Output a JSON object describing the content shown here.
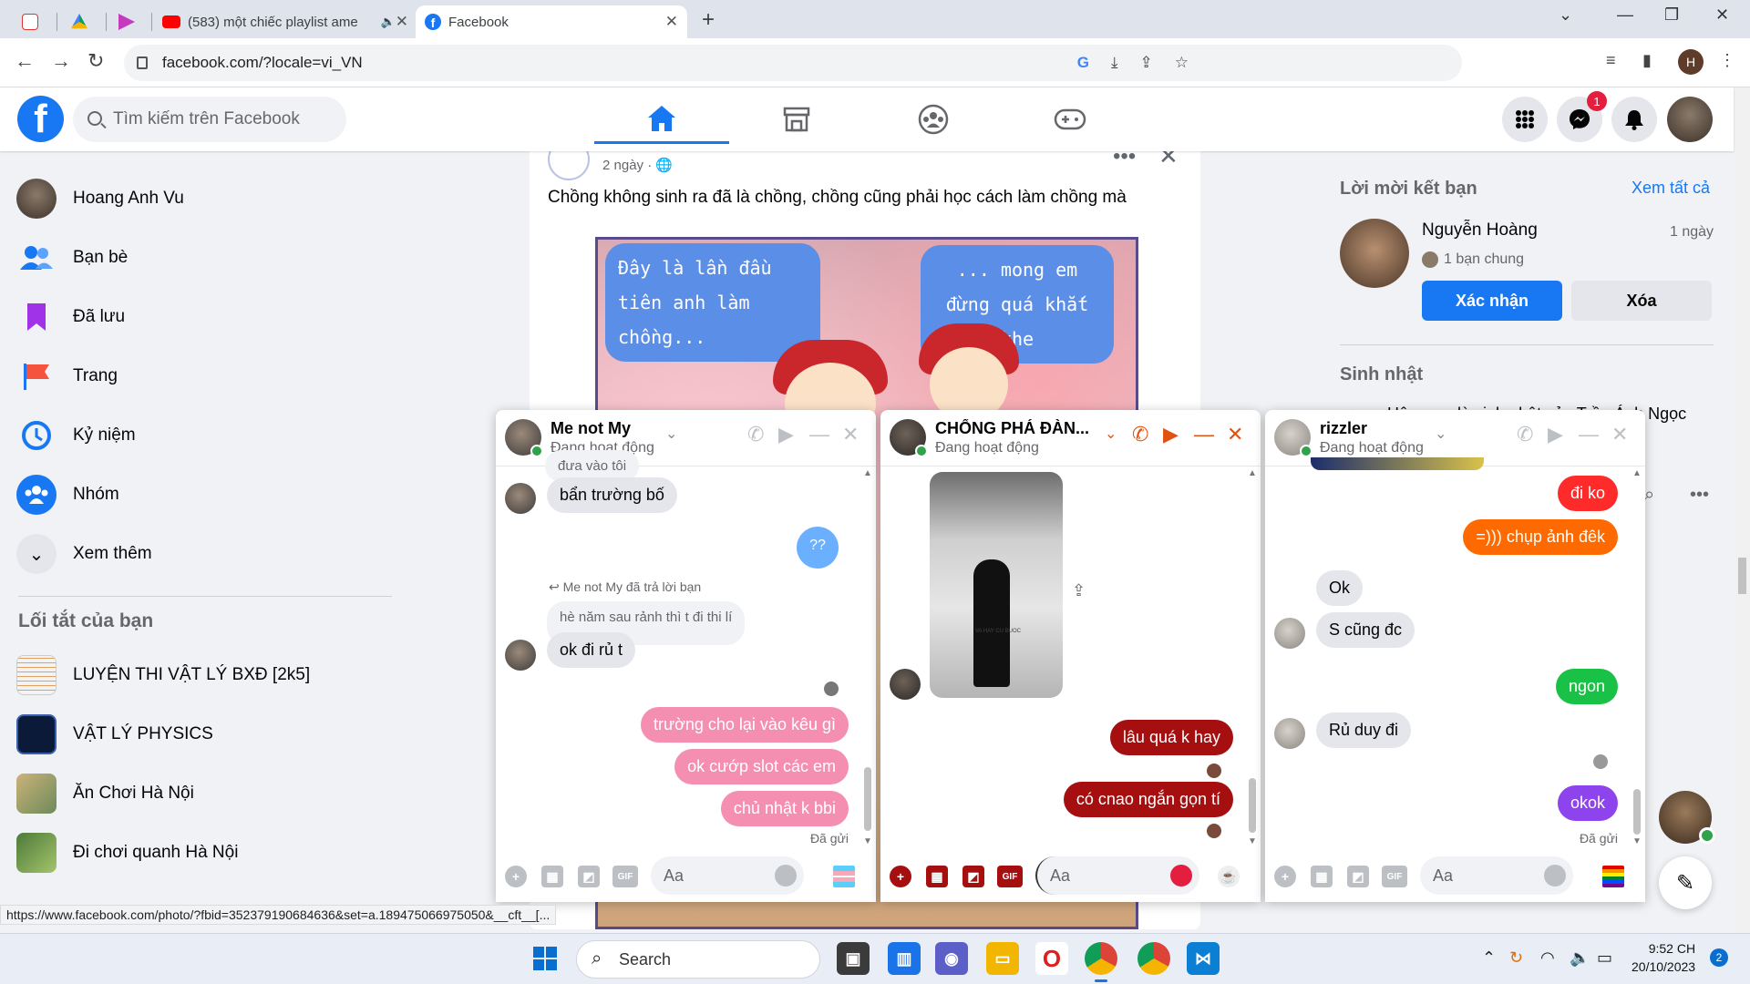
{
  "browser": {
    "tabs": [
      {
        "title": ""
      },
      {
        "title": ""
      },
      {
        "title": ""
      },
      {
        "title": "(583) một chiếc playlist ame"
      },
      {
        "title": "Facebook"
      }
    ],
    "url": "facebook.com/?locale=vi_VN",
    "profile_initial": "H",
    "status_url": "https://www.facebook.com/photo/?fbid=352379190684636&set=a.189475066975050&__cft__[..."
  },
  "header": {
    "search_placeholder": "Tìm kiếm trên Facebook",
    "messenger_badge": "1"
  },
  "sidebar": {
    "items": [
      {
        "label": "Hoang Anh Vu",
        "icon": "avatar"
      },
      {
        "label": "Bạn bè",
        "icon": "friends-icon"
      },
      {
        "label": "Đã lưu",
        "icon": "bookmark-icon"
      },
      {
        "label": "Trang",
        "icon": "flag-icon"
      },
      {
        "label": "Kỷ niệm",
        "icon": "clock-icon"
      },
      {
        "label": "Nhóm",
        "icon": "groups-icon"
      },
      {
        "label": "Xem thêm",
        "icon": "chevron-down-icon"
      }
    ],
    "shortcuts_title": "Lối tắt của bạn",
    "shortcuts": [
      {
        "label": "LUYỆN THI VẬT LÝ BXĐ [2k5]"
      },
      {
        "label": "VẬT LÝ PHYSICS"
      },
      {
        "label": "Ăn Chơi Hà Nội"
      },
      {
        "label": "Đi chơi quanh Hà Nội"
      }
    ]
  },
  "post": {
    "time": "2 ngày ·",
    "text": "Chồng không sinh ra đã là chồng, chồng cũng phải học cách làm chồng mà",
    "comic_bubble_left": "Đây là lần đầu tiên anh làm chồng...",
    "comic_bubble_right": "... mong em đừng quá khắt khe"
  },
  "right": {
    "friend_requests_title": "Lời mời kết bạn",
    "see_all": "Xem tất cả",
    "request": {
      "name": "Nguyễn Hoàng",
      "time": "1 ngày",
      "mutual": "1 bạn chung",
      "confirm": "Xác nhận",
      "delete": "Xóa"
    },
    "birthdays_title": "Sinh nhật",
    "birthday_text": "Hôm nay là sinh nhật của Trần Ánh Ngọc"
  },
  "chats": [
    {
      "name": "Me not My",
      "status": "Đang hoạt động",
      "reply_note": "Me not My đã trả lời bạn",
      "quoted": "hè năm sau rảnh thì t đi thi lí",
      "partial_top": "đưa vào tôi",
      "messages": [
        {
          "text": "bẩn trường bố",
          "dir": "in"
        },
        {
          "text": "??",
          "dir": "out"
        },
        {
          "text": "ok đi rủ t",
          "dir": "in"
        },
        {
          "text": "trường cho lại vào kêu gì",
          "dir": "out"
        },
        {
          "text": "ok cướp slot các em",
          "dir": "out"
        },
        {
          "text": "chủ nhật k bbi",
          "dir": "out"
        }
      ],
      "sent": "Đã gửi",
      "input_placeholder": "Aa"
    },
    {
      "name": "CHỐNG PHÁ ĐÀN...",
      "status": "Đang hoạt động",
      "image_caption": "VA HAY CU BUOC",
      "messages": [
        {
          "text": "lâu quá k hay",
          "dir": "out"
        },
        {
          "text": "có cnao ngắn gọn tí",
          "dir": "out"
        }
      ],
      "input_placeholder": "Aa",
      "accent": "#e0520f"
    },
    {
      "name": "rizzler",
      "status": "Đang hoạt động",
      "messages": [
        {
          "text": "đi ko",
          "dir": "out"
        },
        {
          "text": "=))) chụp ảnh đêk",
          "dir": "out"
        },
        {
          "text": "Ok",
          "dir": "in"
        },
        {
          "text": "S cũng đc",
          "dir": "in"
        },
        {
          "text": "ngon",
          "dir": "out"
        },
        {
          "text": "Rủ duy đi",
          "dir": "in"
        },
        {
          "text": "okok",
          "dir": "out"
        }
      ],
      "sent": "Đã gửi",
      "input_placeholder": "Aa"
    }
  ],
  "taskbar": {
    "search": "Search",
    "time": "9:52 CH",
    "date": "20/10/2023",
    "notif_count": "2"
  },
  "colors": {
    "fb_blue": "#1877f2",
    "pink_bubble": "#f48fb1",
    "dark_red": "#a50f0f",
    "chat2_accent": "#e0520f",
    "green_bubble": "#19c246",
    "purple_bubble": "#8e44ec"
  }
}
